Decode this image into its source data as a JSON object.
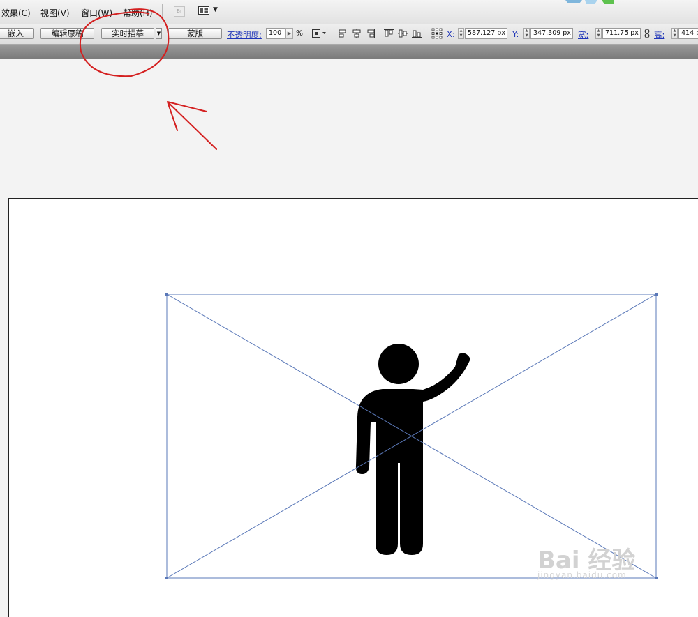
{
  "menu": {
    "items": [
      "效果(C)",
      "视图(V)",
      "窗口(W)",
      "帮助(H)"
    ],
    "bridge_icon_label": "Br"
  },
  "control_bar": {
    "embed_label": "嵌入",
    "edit_original_label": "编辑原稿",
    "live_trace_label": "实时描摹",
    "mask_label": "蒙版",
    "opacity_label": "不透明度:",
    "opacity_value": "100",
    "percent_sign": "%",
    "x_label": "X:",
    "x_value": "587.127 px",
    "y_label": "Y:",
    "y_value": "347.309 px",
    "w_label": "宽:",
    "w_value": "711.75 px",
    "h_label": "高:",
    "h_value": "414 p"
  },
  "watermark": {
    "brand": "Bai 经验",
    "url": "jingyan.baidu.com"
  },
  "colors": {
    "selection": "#5a78b8",
    "annotation": "#d42020",
    "link_label": "#1f35b8"
  }
}
